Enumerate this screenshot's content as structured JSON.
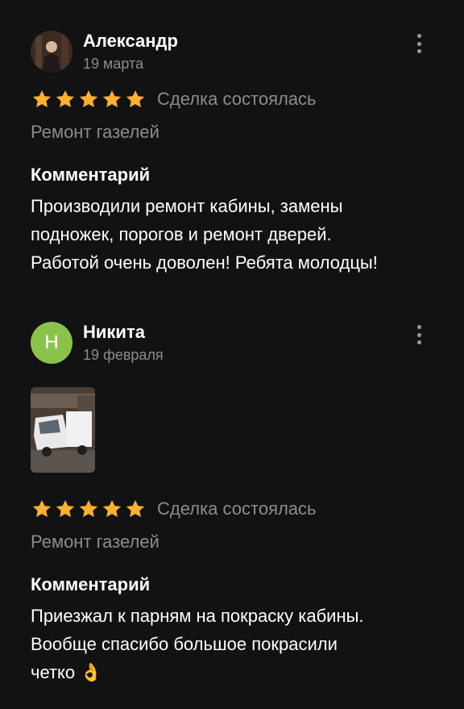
{
  "reviews": [
    {
      "author": "Александр",
      "date": "19 марта",
      "rating": 5,
      "deal_status": "Сделка состоялась",
      "service": "Ремонт газелей",
      "comment_title": "Комментарий",
      "comment_lines": [
        "Производили ремонт кабины, замены",
        "подножек, порогов и ремонт дверей.",
        "Работой очень доволен! Ребята молодцы!"
      ]
    },
    {
      "author": "Никита",
      "avatar_letter": "Н",
      "date": "19 февраля",
      "rating": 5,
      "deal_status": "Сделка состоялась",
      "service": "Ремонт газелей",
      "comment_title": "Комментарий",
      "comment_lines": [
        "Приезжал к парням на покраску кабины.",
        "Вообще спасибо большое покрасили",
        "четко 👌"
      ]
    }
  ],
  "colors": {
    "background": "#121212",
    "star": "#ffb02e",
    "secondary_text": "#8c8c8c",
    "avatar_green": "#8bc34a"
  },
  "icons": {
    "more": "more-vertical-icon",
    "star": "star-icon"
  }
}
